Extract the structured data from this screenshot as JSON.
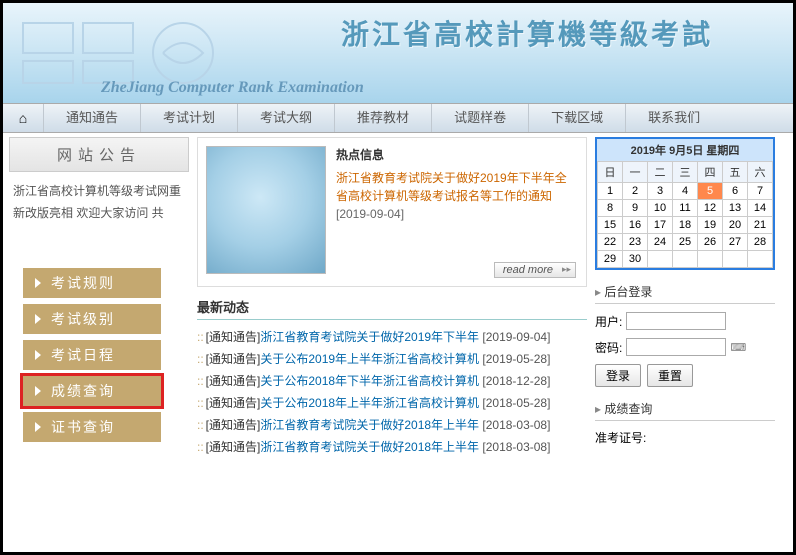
{
  "banner": {
    "title_cn": "浙江省高校計算機等級考試",
    "title_en": "ZheJiang Computer Rank Examination"
  },
  "nav": {
    "home_icon": "⌂",
    "items": [
      "通知通告",
      "考试计划",
      "考试大纲",
      "推荐教材",
      "试题样卷",
      "下载区域",
      "联系我们"
    ]
  },
  "sidebar": {
    "panel_title": "网站公告",
    "announce_lines": [
      "浙江省高校计算机等级考试网重",
      "新改版亮相   欢迎大家访问   共"
    ],
    "buttons": [
      {
        "label": "考试规则",
        "highlight": false
      },
      {
        "label": "考试级别",
        "highlight": false
      },
      {
        "label": "考试日程",
        "highlight": false
      },
      {
        "label": "成绩查询",
        "highlight": true
      },
      {
        "label": "证书查询",
        "highlight": false
      }
    ]
  },
  "hot": {
    "heading": "热点信息",
    "body": "浙江省教育考试院关于做好2019年下半年全省高校计算机等级考试报名等工作的通知",
    "date": "[2019-09-04]",
    "read_more": "read more"
  },
  "news": {
    "heading": "最新动态",
    "items": [
      {
        "cat": "[通知通告]",
        "title": "浙江省教育考试院关于做好2019年下半年",
        "date": "[2019-09-04]"
      },
      {
        "cat": "[通知通告]",
        "title": "关于公布2019年上半年浙江省高校计算机",
        "date": "[2019-05-28]"
      },
      {
        "cat": "[通知通告]",
        "title": "关于公布2018年下半年浙江省高校计算机",
        "date": "[2018-12-28]"
      },
      {
        "cat": "[通知通告]",
        "title": "关于公布2018年上半年浙江省高校计算机",
        "date": "[2018-05-28]"
      },
      {
        "cat": "[通知通告]",
        "title": "浙江省教育考试院关于做好2018年上半年",
        "date": "[2018-03-08]"
      },
      {
        "cat": "[通知通告]",
        "title": "浙江省教育考试院关于做好2018年上半年",
        "date": "[2018-03-08]"
      }
    ]
  },
  "calendar": {
    "header": "2019年 9月5日 星期四",
    "weekdays": [
      "日",
      "一",
      "二",
      "三",
      "四",
      "五",
      "六"
    ],
    "rows": [
      [
        "1",
        "2",
        "3",
        "4",
        "5",
        "6",
        "7"
      ],
      [
        "8",
        "9",
        "10",
        "11",
        "12",
        "13",
        "14"
      ],
      [
        "15",
        "16",
        "17",
        "18",
        "19",
        "20",
        "21"
      ],
      [
        "22",
        "23",
        "24",
        "25",
        "26",
        "27",
        "28"
      ],
      [
        "29",
        "30",
        "",
        "",
        "",
        "",
        ""
      ]
    ],
    "today": "5"
  },
  "login": {
    "heading": "后台登录",
    "user_label": "用户:",
    "pass_label": "密码:",
    "btn_login": "登录",
    "btn_reset": "重置"
  },
  "score": {
    "heading": "成绩查询",
    "field1_label": "准考证号:"
  }
}
